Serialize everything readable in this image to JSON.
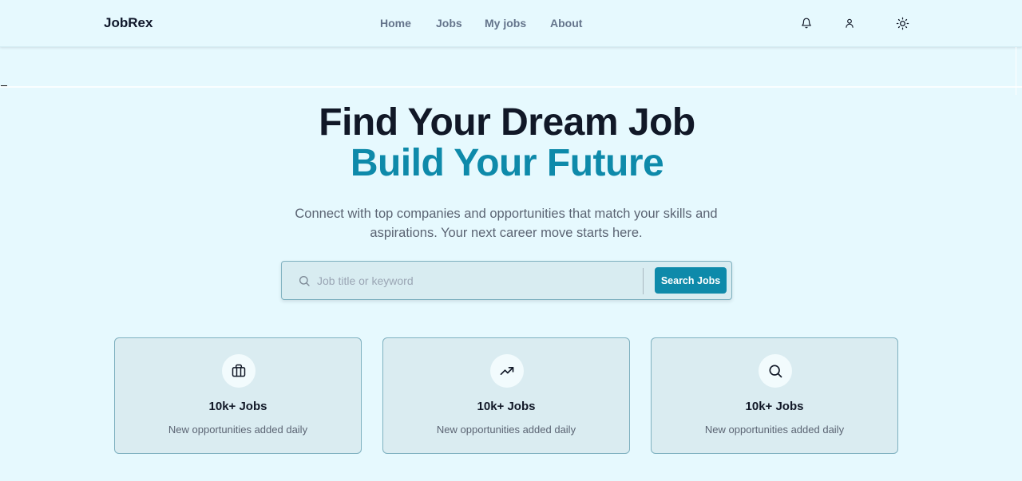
{
  "header": {
    "brand": "JobRex",
    "nav": [
      {
        "label": "Home"
      },
      {
        "label": "Jobs"
      },
      {
        "label": "My jobs"
      },
      {
        "label": "About"
      }
    ],
    "icons": [
      "bell-icon",
      "user-icon",
      "sun-icon"
    ]
  },
  "hero": {
    "title": "Find Your Dream Job",
    "subtitle": "Build Your Future",
    "description": "Connect with top companies and opportunities that match your skills and aspirations. Your next career move starts here."
  },
  "search": {
    "placeholder": "Job title or keyword",
    "value": "",
    "button_label": "Search Jobs"
  },
  "stats": [
    {
      "icon": "briefcase-icon",
      "title": "10k+ Jobs",
      "description": "New opportunities added daily"
    },
    {
      "icon": "trending-up-icon",
      "title": "10k+ Jobs",
      "description": "New opportunities added daily"
    },
    {
      "icon": "search-icon",
      "title": "10k+ Jobs",
      "description": "New opportunities added daily"
    }
  ],
  "colors": {
    "background": "#e6f9fe",
    "accent": "#0e8aaa",
    "heading": "#111827",
    "muted_text": "#5b6473",
    "card_bg": "#daecf1",
    "card_border": "#7fb1c0"
  }
}
